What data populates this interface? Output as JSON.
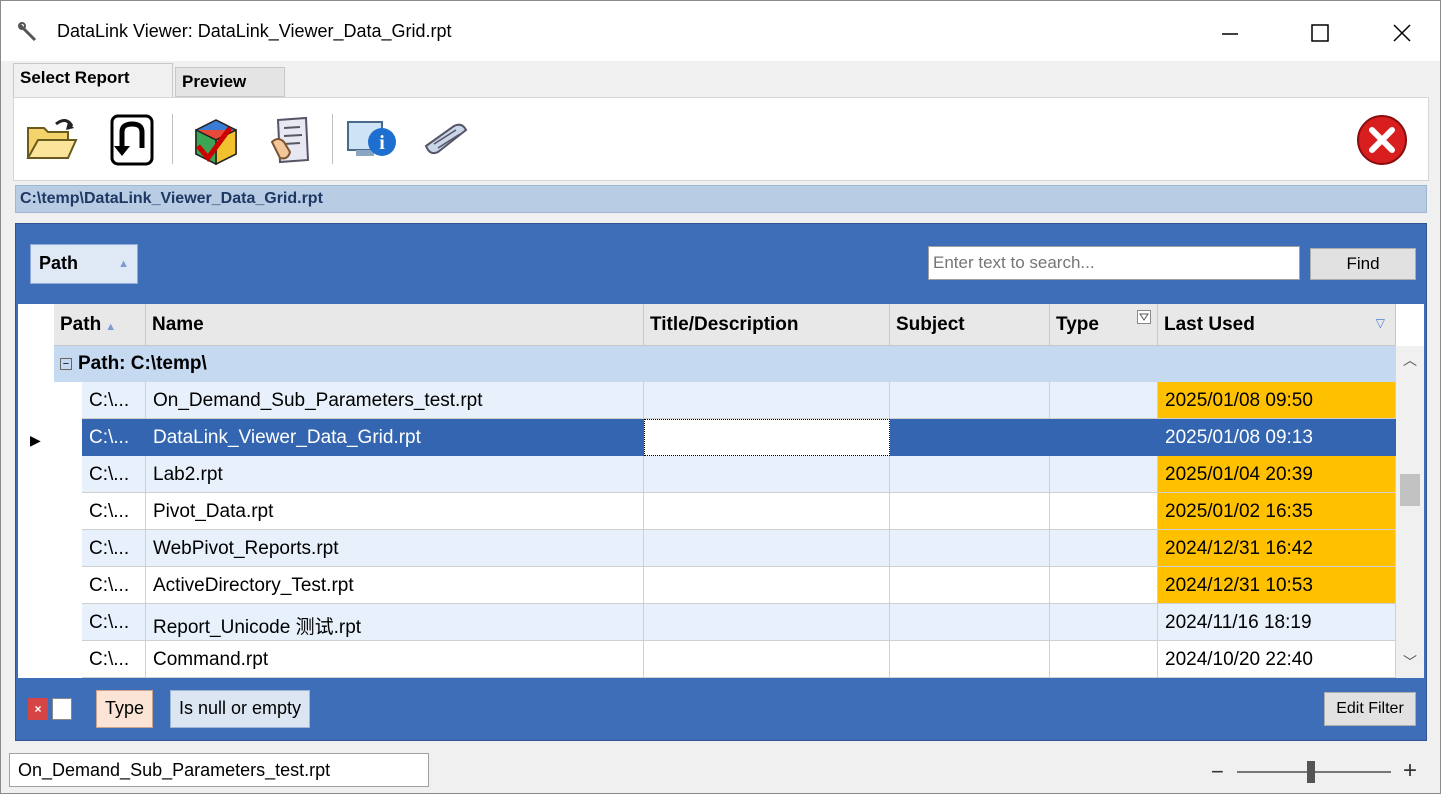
{
  "window": {
    "title": "DataLink Viewer:  DataLink_Viewer_Data_Grid.rpt",
    "app_icon": "wrench-icon"
  },
  "tabs": [
    {
      "label": "Select Report",
      "active": true
    },
    {
      "label": "Preview",
      "active": false
    }
  ],
  "toolbar": {
    "icons": [
      "open-folder-icon",
      "undo-icon",
      "rubik-cube-icon",
      "map-hand-icon",
      "info-computer-icon",
      "scroll-icon",
      "close-report-icon"
    ]
  },
  "path_bar": "C:\\temp\\DataLink_Viewer_Data_Grid.rpt",
  "group_panel": {
    "chip_label": "Path"
  },
  "search": {
    "placeholder": "Enter text to search...",
    "find_label": "Find"
  },
  "grid": {
    "columns": [
      "Path",
      "Name",
      "Title/Description",
      "Subject",
      "Type",
      "Last Used"
    ],
    "group_label": "Path: C:\\temp\\",
    "rows": [
      {
        "path": "C:\\...",
        "name": "On_Demand_Sub_Parameters_test.rpt",
        "title": "",
        "subject": "",
        "type": "",
        "last_used": "2025/01/08  09:50",
        "highlight": true
      },
      {
        "path": "C:\\...",
        "name": "DataLink_Viewer_Data_Grid.rpt",
        "title": "",
        "subject": "",
        "type": "",
        "last_used": "2025/01/08  09:13",
        "selected": true
      },
      {
        "path": "C:\\...",
        "name": "Lab2.rpt",
        "title": "",
        "subject": "",
        "type": "",
        "last_used": "2025/01/04  20:39",
        "highlight": true
      },
      {
        "path": "C:\\...",
        "name": "Pivot_Data.rpt",
        "title": "",
        "subject": "",
        "type": "",
        "last_used": "2025/01/02  16:35",
        "highlight": true
      },
      {
        "path": "C:\\...",
        "name": "WebPivot_Reports.rpt",
        "title": "",
        "subject": "",
        "type": "",
        "last_used": "2024/12/31  16:42",
        "highlight": true
      },
      {
        "path": "C:\\...",
        "name": "ActiveDirectory_Test.rpt",
        "title": "",
        "subject": "",
        "type": "",
        "last_used": "2024/12/31  10:53",
        "highlight": true
      },
      {
        "path": "C:\\...",
        "name": "Report_Unicode 测试.rpt",
        "title": "",
        "subject": "",
        "type": "",
        "last_used": "2024/11/16  18:19"
      },
      {
        "path": "C:\\...",
        "name": "Command.rpt",
        "title": "",
        "subject": "",
        "type": "",
        "last_used": "2024/10/20  22:40"
      }
    ],
    "highlight_color": "#ffc000",
    "selected_color": "#3465b0"
  },
  "filter": {
    "field": "Type",
    "condition": "Is null or empty",
    "edit_label": "Edit Filter"
  },
  "status": {
    "text": "On_Demand_Sub_Parameters_test.rpt"
  }
}
